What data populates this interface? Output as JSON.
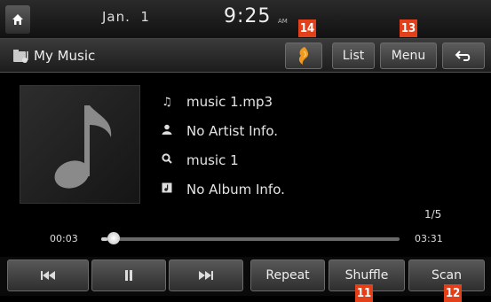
{
  "status_bar": {
    "date": "Jan.  1",
    "time": "9:25",
    "ampm": "AM",
    "home_icon": "home-icon"
  },
  "toolbar": {
    "source_title": "My Music",
    "source_icon": "music-folder-icon",
    "orange_button_icon": "media-source-icon",
    "list_label": "List",
    "menu_label": "Menu",
    "back_icon": "back-arrow-icon"
  },
  "callouts": {
    "badge_14": "14",
    "badge_13": "13",
    "badge_11": "11",
    "badge_12": "12"
  },
  "track_info": {
    "title": "music 1.mp3",
    "artist": "No Artist Info.",
    "folder": "music 1",
    "album": "No Album Info."
  },
  "playback": {
    "track_count": "1/5",
    "elapsed": "00:03",
    "total": "03:31",
    "progress_fraction": 0.02
  },
  "controls": {
    "prev_icon": "skip-previous-icon",
    "pause_icon": "pause-icon",
    "next_icon": "skip-next-icon",
    "repeat_label": "Repeat",
    "shuffle_label": "Shuffle",
    "scan_label": "Scan"
  },
  "colors": {
    "callout": "#e2401a",
    "source_orange": "#f39a1c"
  }
}
